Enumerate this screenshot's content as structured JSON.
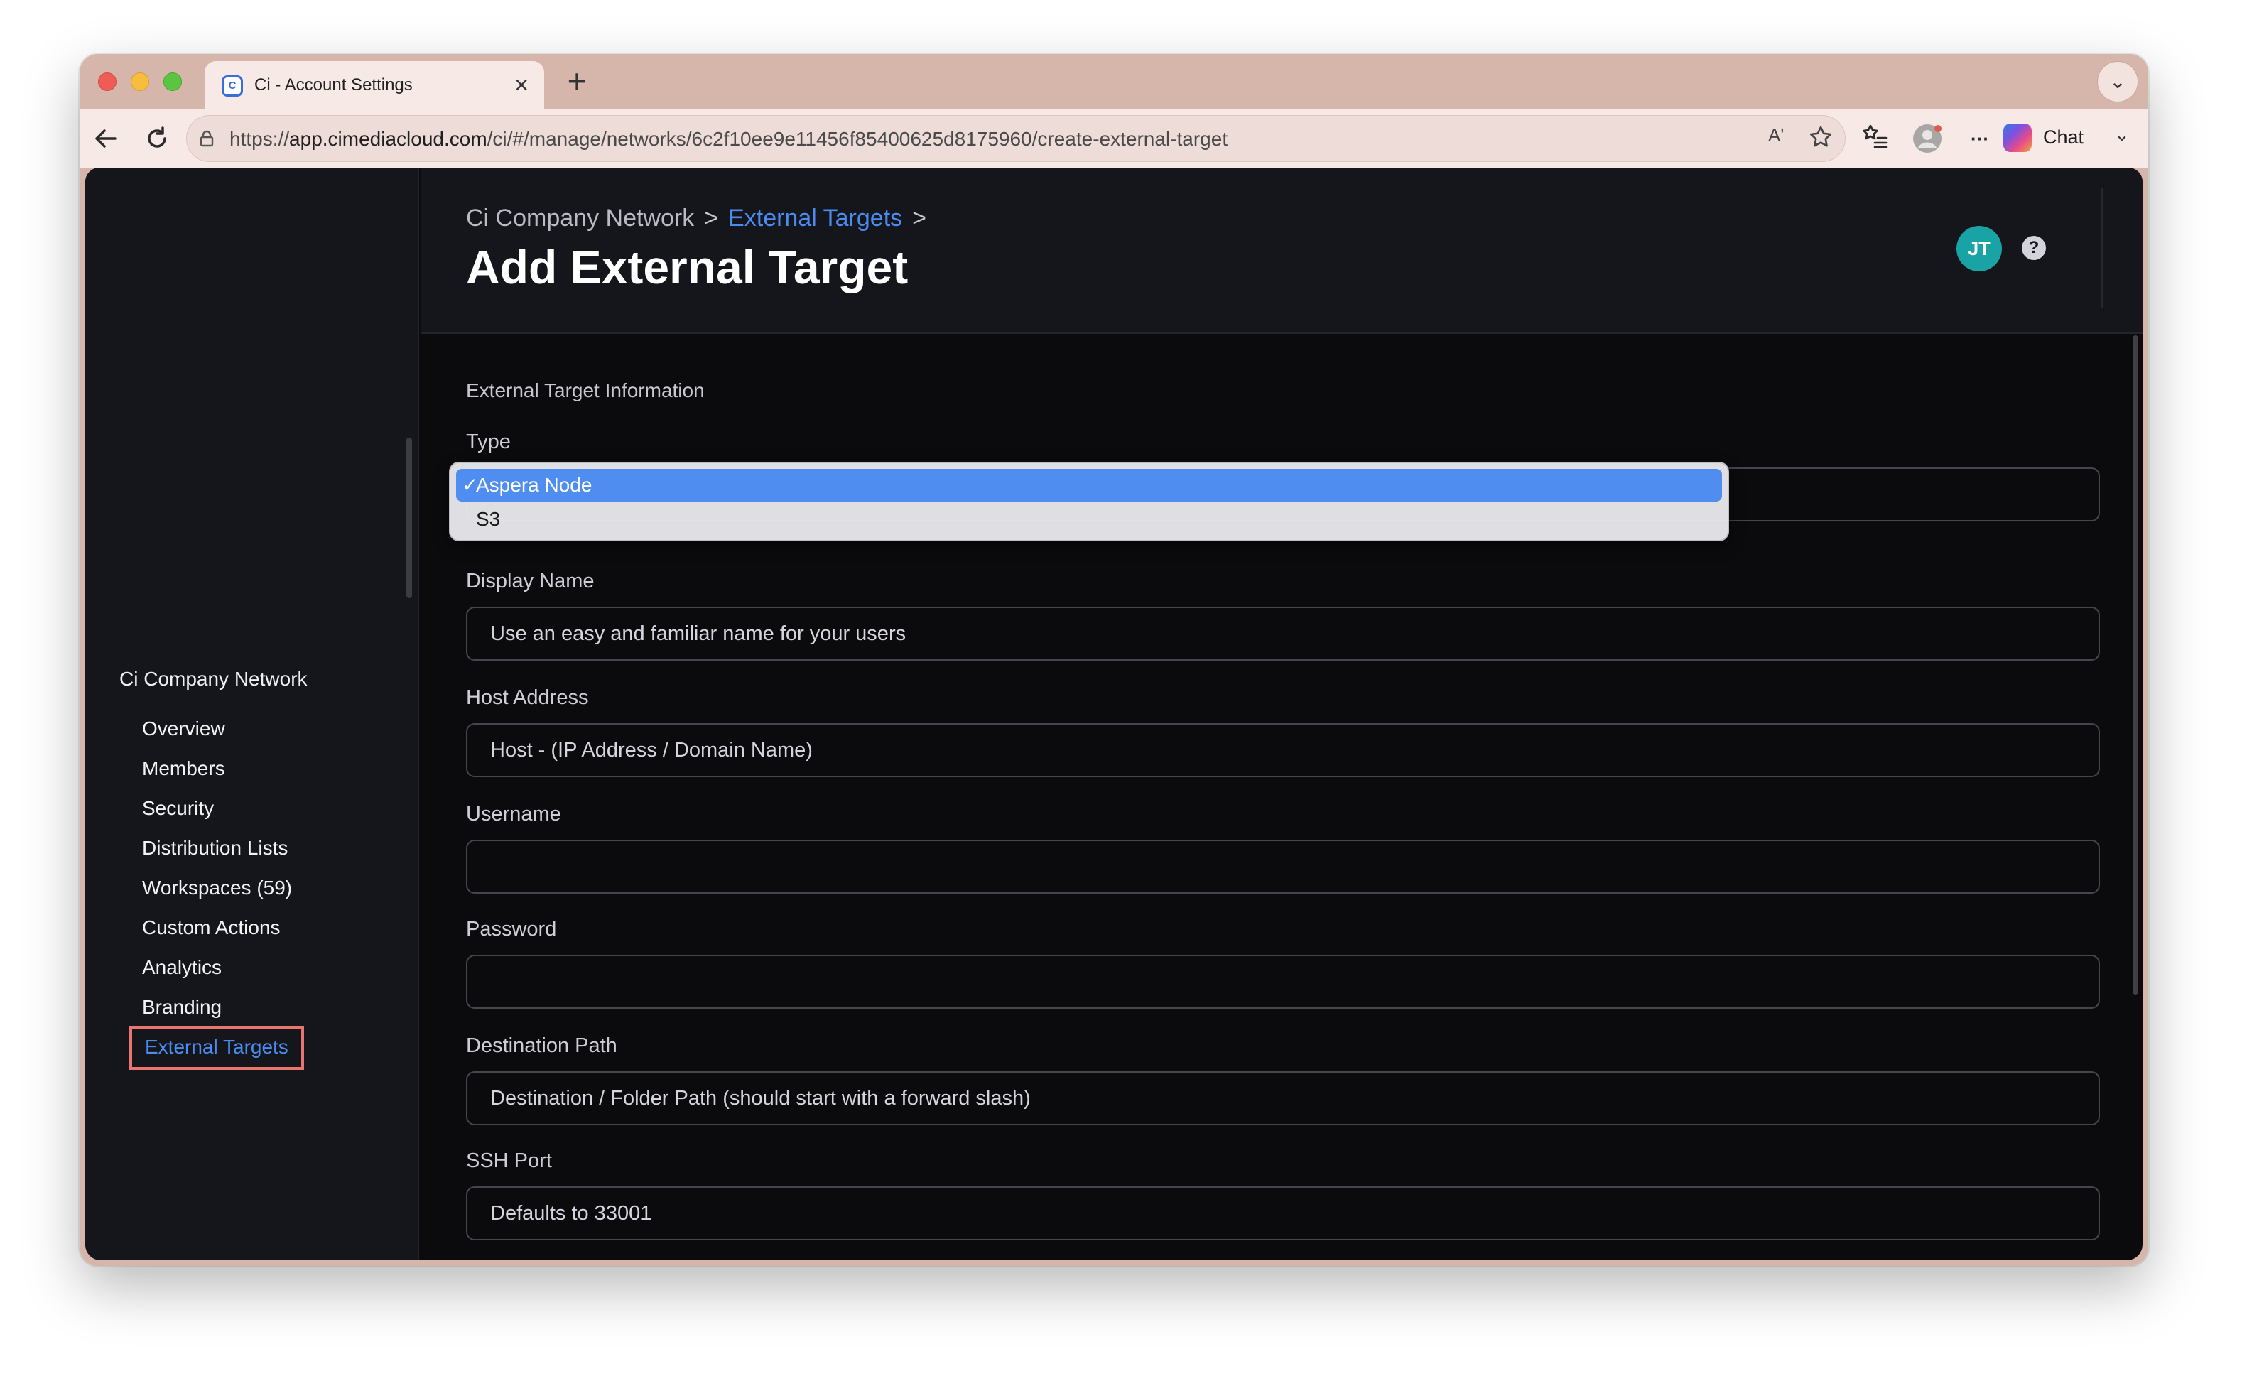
{
  "browser": {
    "tab_title": "Ci - Account Settings",
    "tab_favicon": "C",
    "close_glyph": "×",
    "new_tab_glyph": "+",
    "tab_menu_glyph": "⌄",
    "url_prefix": "https://",
    "url_host": "app.cimediacloud.com",
    "url_path": "/ci/#/manage/networks/6c2f10ee9e11456f85400625d8175960/create-external-target",
    "read_aloud_glyph": "Aʹ",
    "chat_label": "Chat",
    "chat_chevron": "⌄",
    "more_glyph": "···"
  },
  "header": {
    "breadcrumb": [
      "Ci Company Network",
      "External Targets"
    ],
    "breadcrumb_sep": ">",
    "title": "Add External Target",
    "avatar_initials": "JT",
    "help_glyph": "?"
  },
  "sidebar": {
    "network_name": "Ci Company Network",
    "items": [
      {
        "label": "Overview"
      },
      {
        "label": "Members"
      },
      {
        "label": "Security"
      },
      {
        "label": "Distribution Lists"
      },
      {
        "label": "Workspaces (59)"
      },
      {
        "label": "Custom Actions"
      },
      {
        "label": "Analytics"
      },
      {
        "label": "Branding"
      },
      {
        "label": "External Targets",
        "active": true
      }
    ]
  },
  "form": {
    "section_title": "External Target Information",
    "type": {
      "label": "Type",
      "options": [
        "Aspera Node",
        "S3"
      ],
      "selected": "Aspera Node",
      "check_glyph": "✓"
    },
    "display_name": {
      "label": "Display Name",
      "placeholder": "Use an easy and familiar name for your users"
    },
    "host_address": {
      "label": "Host Address",
      "placeholder": "Host - (IP Address / Domain Name)"
    },
    "username": {
      "label": "Username",
      "placeholder": ""
    },
    "password": {
      "label": "Password",
      "placeholder": ""
    },
    "destination_path": {
      "label": "Destination Path",
      "placeholder": "Destination / Folder Path (should start with a forward slash)"
    },
    "ssh_port": {
      "label": "SSH Port",
      "placeholder": "Defaults to 33001"
    }
  },
  "colors": {
    "accent": "#4b8cf0",
    "active_highlight_border": "#e8766f",
    "avatar": "#1aa3a5",
    "app_bg": "#0b0b0e",
    "panel_bg": "#15161b"
  }
}
